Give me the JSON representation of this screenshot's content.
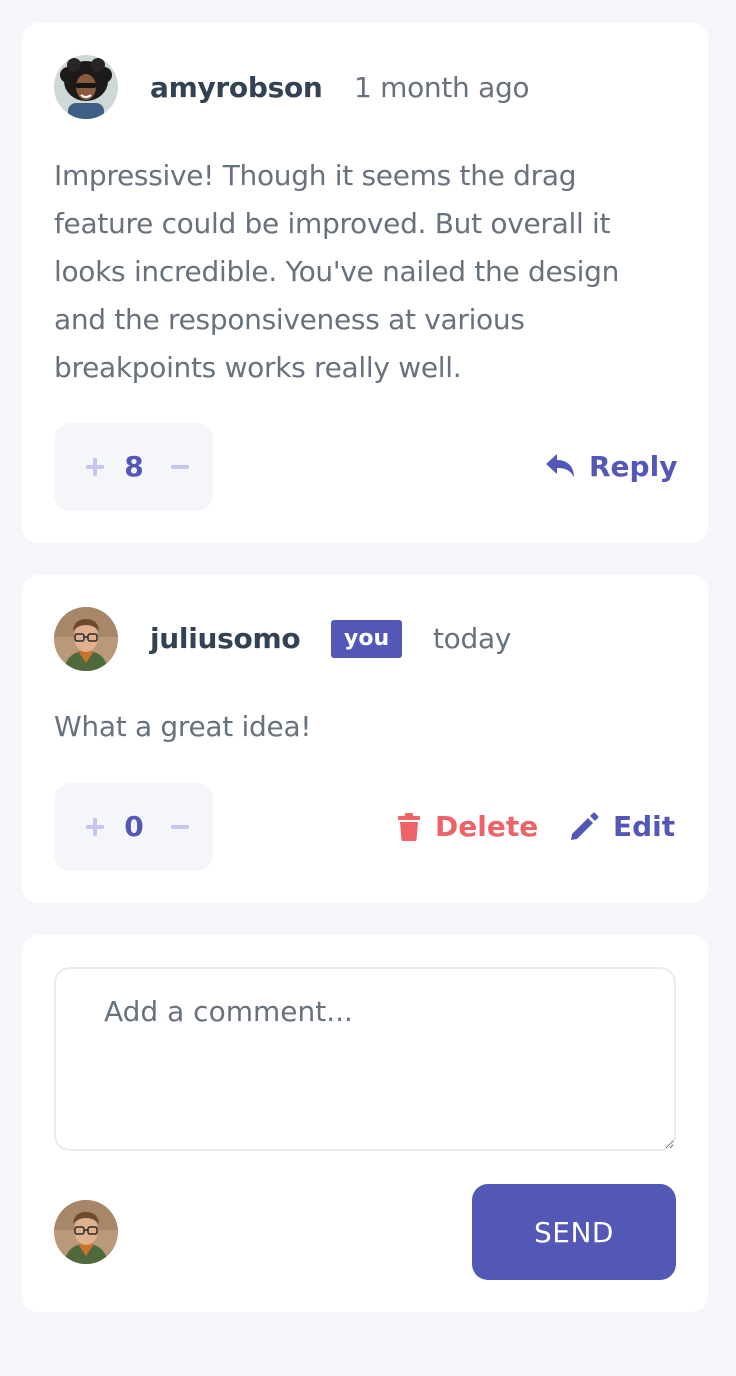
{
  "comments": [
    {
      "username": "amyrobson",
      "timestamp": "1 month ago",
      "content": "Impressive! Though it seems the drag feature could be improved. But overall it looks incredible. You've nailed the design and the responsiveness at various breakpoints works really well.",
      "score": "8",
      "actions": {
        "reply": "Reply"
      }
    },
    {
      "username": "juliusomo",
      "badge": "you",
      "timestamp": "today",
      "content": "What a great idea!",
      "score": "0",
      "actions": {
        "delete": "Delete",
        "edit": "Edit"
      }
    }
  ],
  "composer": {
    "placeholder": "Add a comment...",
    "send_label": "SEND"
  },
  "icons": {
    "vote_up": "plus-icon",
    "vote_down": "minus-icon",
    "reply": "reply-icon",
    "delete": "trash-icon",
    "edit": "pencil-icon"
  },
  "colors": {
    "primary": "#5357b6",
    "vote_icon": "#c5c6ef",
    "danger": "#ed6368",
    "text": "#67727e",
    "heading": "#334253",
    "background": "#f5f6fa",
    "card": "#ffffff"
  }
}
